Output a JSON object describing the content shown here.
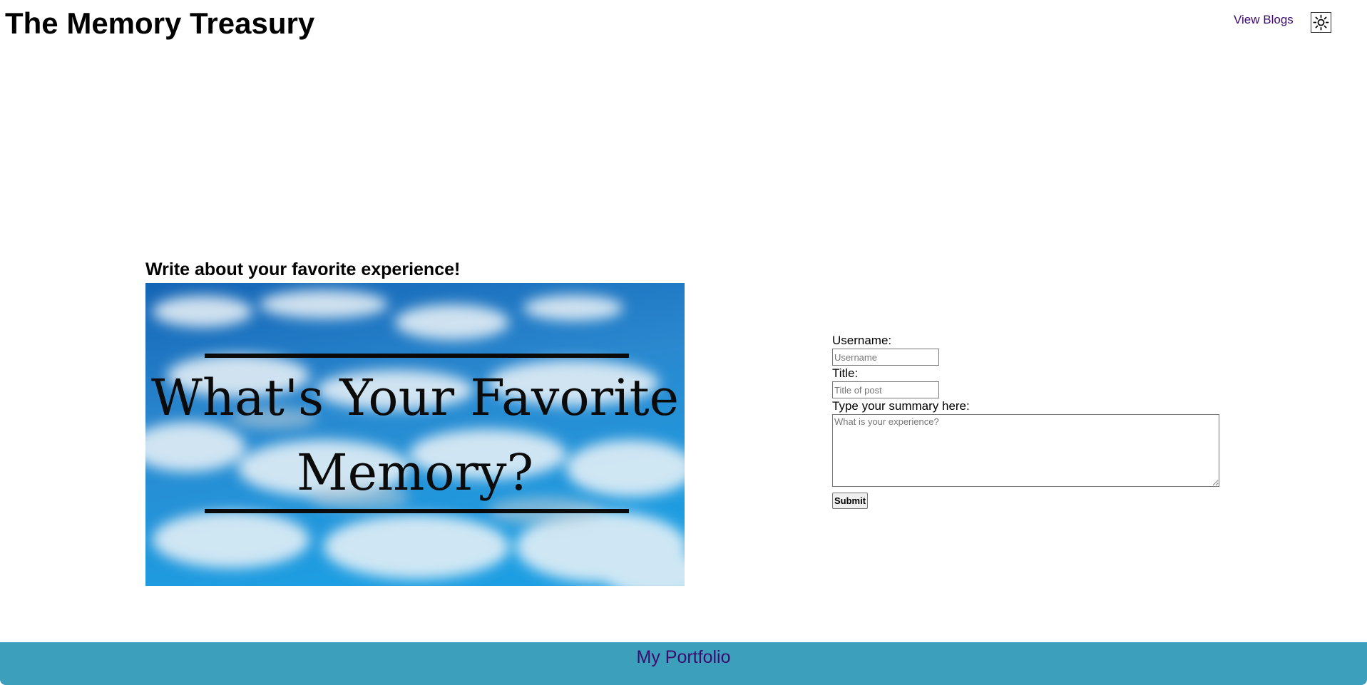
{
  "header": {
    "site_title": "The Memory Treasury",
    "nav_view_blogs": "View Blogs",
    "theme_toggle_icon": "sun-icon"
  },
  "main": {
    "heading": "Write about your favorite experience!",
    "image": {
      "line1": "What's Your Favorite",
      "line2": "Memory?"
    },
    "form": {
      "username_label": "Username:",
      "username_placeholder": "Username",
      "username_value": "",
      "title_label": "Title:",
      "title_placeholder": "Title of post",
      "title_value": "",
      "summary_label": "Type your summary here:",
      "summary_placeholder": "What is your experience?",
      "summary_value": "",
      "submit_label": "Submit"
    }
  },
  "footer": {
    "portfolio_link": "My Portfolio"
  },
  "colors": {
    "link": "#3d0b6e",
    "footer_bg": "#3ca0bd",
    "sky_top": "#1668b8",
    "sky_bottom": "#1d9be0"
  }
}
